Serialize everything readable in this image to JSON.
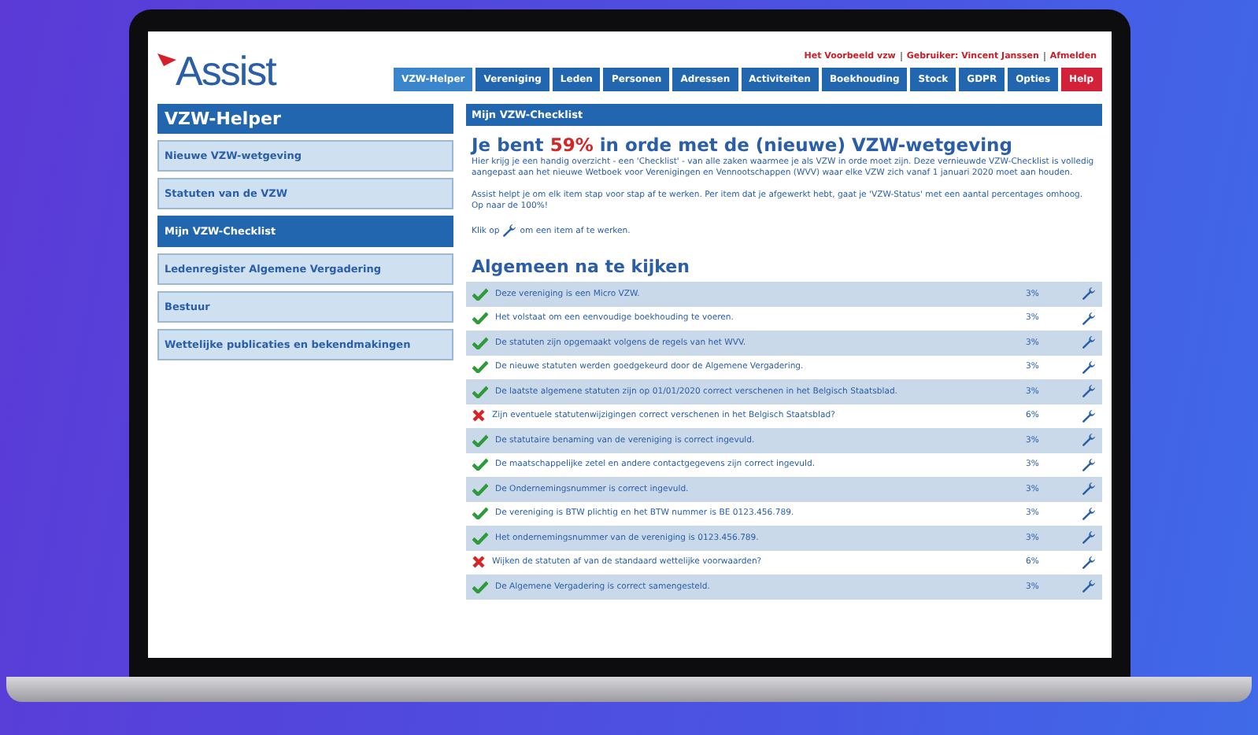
{
  "header": {
    "logo": "Assist",
    "user_links": [
      "Het Voorbeeld vzw",
      "Gebruiker: Vincent Janssen",
      "Afmelden"
    ]
  },
  "nav": [
    {
      "label": "VZW-Helper",
      "selected": true,
      "kind": "normal"
    },
    {
      "label": "Vereniging",
      "selected": false,
      "kind": "normal"
    },
    {
      "label": "Leden",
      "selected": false,
      "kind": "normal"
    },
    {
      "label": "Personen",
      "selected": false,
      "kind": "normal"
    },
    {
      "label": "Adressen",
      "selected": false,
      "kind": "normal"
    },
    {
      "label": "Activiteiten",
      "selected": false,
      "kind": "normal"
    },
    {
      "label": "Boekhouding",
      "selected": false,
      "kind": "normal"
    },
    {
      "label": "Stock",
      "selected": false,
      "kind": "normal"
    },
    {
      "label": "GDPR",
      "selected": false,
      "kind": "normal"
    },
    {
      "label": "Opties",
      "selected": false,
      "kind": "normal"
    },
    {
      "label": "Help",
      "selected": false,
      "kind": "help"
    }
  ],
  "sidebar": {
    "title": "VZW-Helper",
    "items": [
      {
        "label": "Nieuwe VZW-wetgeving",
        "selected": false
      },
      {
        "label": "Statuten van de VZW",
        "selected": false
      },
      {
        "label": "Mijn VZW-Checklist",
        "selected": true
      },
      {
        "label": "Ledenregister Algemene Vergadering",
        "selected": false
      },
      {
        "label": "Bestuur",
        "selected": false
      },
      {
        "label": "Wettelijke publicaties en bekendmakingen",
        "selected": false
      }
    ]
  },
  "main": {
    "panel_title": "Mijn VZW-Checklist",
    "heading": {
      "before": "Je bent",
      "percent": "59%",
      "after": "in orde met de (nieuwe) VZW-wetgeving"
    },
    "paragraphs": [
      "Hier krijg je een handig overzicht - een 'Checklist' - van alle zaken waarmee je als VZW in orde moet zijn. Deze vernieuwde VZW-Checklist is volledig aangepast aan het nieuwe Wetboek voor Verenigingen en Vennootschappen (WVV) waar elke VZW zich vanaf 1 januari 2020 moet aan houden.",
      "Assist helpt je om elk item stap voor stap af te werken. Per item dat je afgewerkt hebt, gaat je 'VZW-Status' met een aantal percentages omhoog. Op naar de 100%!"
    ],
    "hint_before": "Klik op",
    "hint_after": "om een item af te werken.",
    "section_title": "Algemeen na te kijken",
    "rows": [
      {
        "text": "Deze vereniging is een Micro VZW.",
        "percent": "3%",
        "done": true
      },
      {
        "text": "Het volstaat om een eenvoudige boekhouding te voeren.",
        "percent": "3%",
        "done": true
      },
      {
        "text": "De statuten zijn opgemaakt volgens de regels van het WVV.",
        "percent": "3%",
        "done": true
      },
      {
        "text": "De nieuwe statuten werden goedgekeurd door de Algemene Vergadering.",
        "percent": "3%",
        "done": true
      },
      {
        "text": "De laatste algemene statuten zijn op 01/01/2020 correct verschenen in het Belgisch Staatsblad.",
        "percent": "3%",
        "done": true
      },
      {
        "text": "Zijn eventuele statutenwijzigingen correct verschenen in het Belgisch Staatsblad?",
        "percent": "6%",
        "done": false
      },
      {
        "text": "De statutaire benaming van de vereniging is correct ingevuld.",
        "percent": "3%",
        "done": true
      },
      {
        "text": "De maatschappelijke zetel en andere contactgegevens zijn correct ingevuld.",
        "percent": "3%",
        "done": true
      },
      {
        "text": "De Ondernemingsnummer is correct ingevuld.",
        "percent": "3%",
        "done": true
      },
      {
        "text": "De vereniging is BTW plichtig en het BTW nummer is BE 0123.456.789.",
        "percent": "3%",
        "done": true
      },
      {
        "text": "Het ondernemingsnummer van de vereniging is 0123.456.789.",
        "percent": "3%",
        "done": true
      },
      {
        "text": "Wijken de statuten af van de standaard wettelijke voorwaarden?",
        "percent": "6%",
        "done": false
      },
      {
        "text": "De Algemene Vergadering is correct samengesteld.",
        "percent": "3%",
        "done": true
      }
    ]
  }
}
